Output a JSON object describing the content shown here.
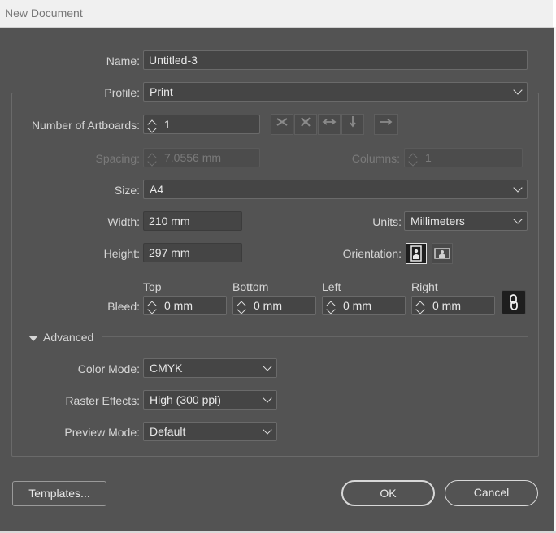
{
  "window": {
    "title": "New Document"
  },
  "name": {
    "label": "Name:",
    "value": "Untitled-3"
  },
  "profile": {
    "label": "Profile:",
    "value": "Print"
  },
  "artboards": {
    "label": "Number of Artboards:",
    "value": "1"
  },
  "spacing": {
    "label": "Spacing:",
    "value": "7.0556 mm"
  },
  "columns": {
    "label": "Columns:",
    "value": "1"
  },
  "size": {
    "label": "Size:",
    "value": "A4"
  },
  "width": {
    "label": "Width:",
    "value": "210 mm"
  },
  "height": {
    "label": "Height:",
    "value": "297 mm"
  },
  "units": {
    "label": "Units:",
    "value": "Millimeters"
  },
  "orientation": {
    "label": "Orientation:"
  },
  "bleed": {
    "label": "Bleed:",
    "top": {
      "label": "Top",
      "value": "0 mm"
    },
    "bottom": {
      "label": "Bottom",
      "value": "0 mm"
    },
    "left": {
      "label": "Left",
      "value": "0 mm"
    },
    "right": {
      "label": "Right",
      "value": "0 mm"
    }
  },
  "advanced": {
    "label": "Advanced",
    "color_mode": {
      "label": "Color Mode:",
      "value": "CMYK"
    },
    "raster_effects": {
      "label": "Raster Effects:",
      "value": "High (300 ppi)"
    },
    "preview_mode": {
      "label": "Preview Mode:",
      "value": "Default"
    }
  },
  "buttons": {
    "templates": "Templates...",
    "ok": "OK",
    "cancel": "Cancel"
  },
  "icons": {
    "artboard_arrange": [
      "grid-by-row-icon",
      "grid-by-column-icon",
      "arrange-by-row-icon",
      "arrange-by-column-icon",
      "right-to-left-icon"
    ],
    "orientation": [
      "portrait-icon",
      "landscape-icon"
    ],
    "link": "link-icon"
  }
}
